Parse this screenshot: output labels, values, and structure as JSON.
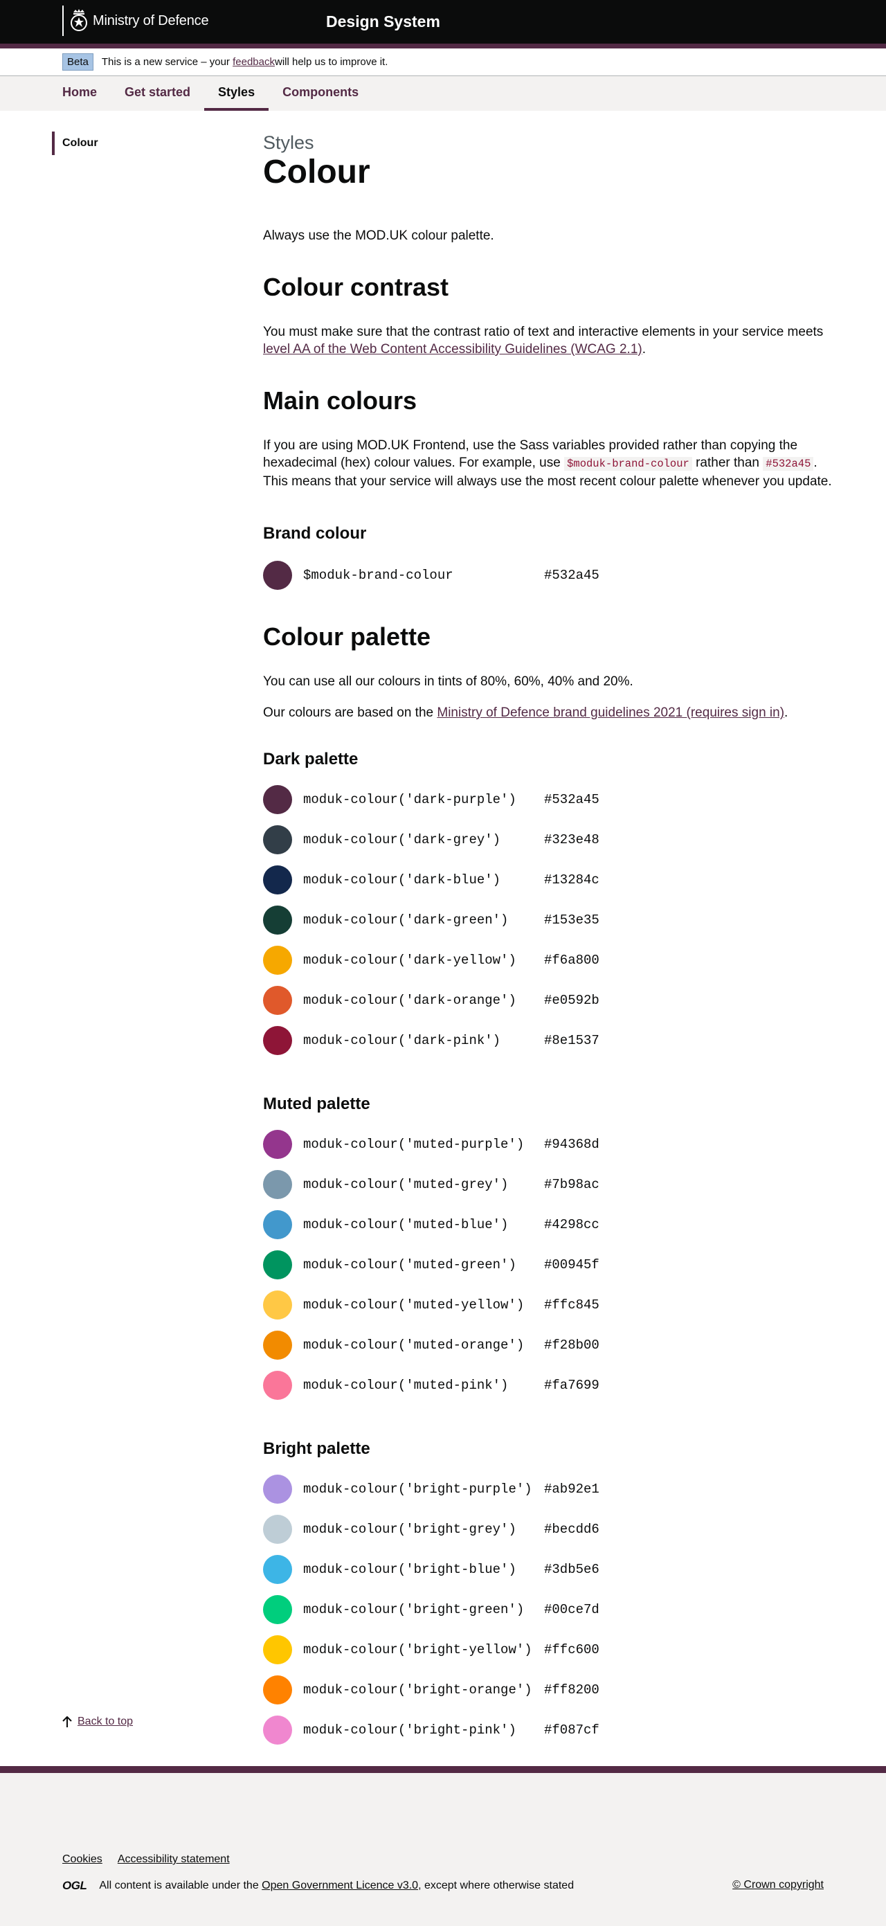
{
  "header": {
    "org_name": "Ministry of Defence",
    "service_name": "Design System"
  },
  "beta": {
    "tag": "Beta",
    "text_before": "This is a new service – your ",
    "link": "feedback",
    "text_after": " will help us to improve it."
  },
  "nav": {
    "items": [
      {
        "label": "Home"
      },
      {
        "label": "Get started"
      },
      {
        "label": "Styles",
        "active": true
      },
      {
        "label": "Components"
      }
    ]
  },
  "sidebar": {
    "items": [
      {
        "label": "Colour"
      }
    ]
  },
  "page": {
    "caption": "Styles",
    "title": "Colour",
    "lead": "Always use the MOD.UK colour palette."
  },
  "contrast": {
    "heading": "Colour contrast",
    "text": "You must make sure that the contrast ratio of text and interactive elements in your service meets ",
    "link": "level AA of the Web Content Accessibility Guidelines (WCAG 2.1)",
    "text_after": "."
  },
  "main_colours": {
    "heading": "Main colours",
    "text1": "If you are using MOD.UK Frontend, use the Sass variables provided rather than copying the hexadecimal (hex) colour values. For example, use ",
    "code1": "$moduk-brand-colour",
    "text2": " rather than ",
    "code2": "#532a45",
    "text3": ". This means that your service will always use the most recent colour palette whenever you update."
  },
  "brand": {
    "heading": "Brand colour",
    "name": "$moduk-brand-colour",
    "hex": "#532a45"
  },
  "palette": {
    "heading": "Colour palette",
    "text1": "You can use all our colours in tints of 80%, 60%, 40% and 20%.",
    "text2_before": "Our colours are based on the ",
    "text2_link": "Ministry of Defence brand guidelines 2021 (requires sign in)",
    "text2_after": "."
  },
  "dark": {
    "heading": "Dark palette",
    "colours": [
      {
        "name": "moduk-colour('dark-purple')",
        "hex": "#532a45"
      },
      {
        "name": "moduk-colour('dark-grey')",
        "hex": "#323e48"
      },
      {
        "name": "moduk-colour('dark-blue')",
        "hex": "#13284c"
      },
      {
        "name": "moduk-colour('dark-green')",
        "hex": "#153e35"
      },
      {
        "name": "moduk-colour('dark-yellow')",
        "hex": "#f6a800"
      },
      {
        "name": "moduk-colour('dark-orange')",
        "hex": "#e0592b"
      },
      {
        "name": "moduk-colour('dark-pink')",
        "hex": "#8e1537"
      }
    ]
  },
  "muted": {
    "heading": "Muted palette",
    "colours": [
      {
        "name": "moduk-colour('muted-purple')",
        "hex": "#94368d"
      },
      {
        "name": "moduk-colour('muted-grey')",
        "hex": "#7b98ac"
      },
      {
        "name": "moduk-colour('muted-blue')",
        "hex": "#4298cc"
      },
      {
        "name": "moduk-colour('muted-green')",
        "hex": "#00945f"
      },
      {
        "name": "moduk-colour('muted-yellow')",
        "hex": "#ffc845"
      },
      {
        "name": "moduk-colour('muted-orange')",
        "hex": "#f28b00"
      },
      {
        "name": "moduk-colour('muted-pink')",
        "hex": "#fa7699"
      }
    ]
  },
  "bright": {
    "heading": "Bright palette",
    "colours": [
      {
        "name": "moduk-colour('bright-purple')",
        "hex": "#ab92e1"
      },
      {
        "name": "moduk-colour('bright-grey')",
        "hex": "#becdd6"
      },
      {
        "name": "moduk-colour('bright-blue')",
        "hex": "#3db5e6"
      },
      {
        "name": "moduk-colour('bright-green')",
        "hex": "#00ce7d"
      },
      {
        "name": "moduk-colour('bright-yellow')",
        "hex": "#ffc600"
      },
      {
        "name": "moduk-colour('bright-orange')",
        "hex": "#ff8200"
      },
      {
        "name": "moduk-colour('bright-pink')",
        "hex": "#f087cf"
      }
    ]
  },
  "back_to_top": "Back to top",
  "footer": {
    "links": [
      {
        "label": "Cookies"
      },
      {
        "label": "Accessibility statement"
      }
    ],
    "ogl": "OGL",
    "licence_before": "All content is available under the ",
    "licence_link": "Open Government Licence v3.0",
    "licence_after": ", except where otherwise stated",
    "copyright": "© Crown copyright"
  }
}
